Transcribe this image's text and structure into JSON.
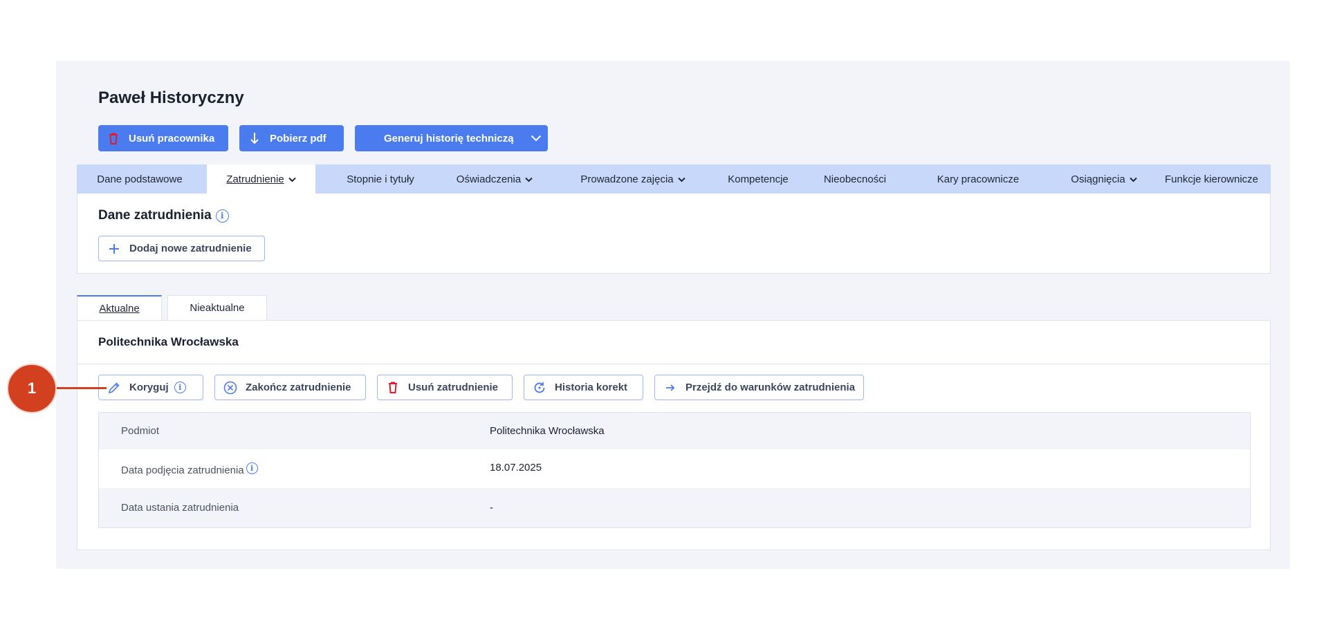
{
  "header": {
    "title": "Paweł Historyczny"
  },
  "actions": {
    "delete_employee": "Usuń pracownika",
    "download_pdf": "Pobierz pdf",
    "generate_history": "Generuj historię techniczą"
  },
  "tabs": [
    {
      "label": "Dane podstawowe"
    },
    {
      "label": "Zatrudnienie",
      "active": true
    },
    {
      "label": "Stopnie i tytuły"
    },
    {
      "label": "Oświadczenia"
    },
    {
      "label": "Prowadzone zajęcia"
    },
    {
      "label": "Kompetencje"
    },
    {
      "label": "Nieobecności"
    },
    {
      "label": "Kary pracownicze"
    },
    {
      "label": "Osiągnięcia"
    },
    {
      "label": "Funkcje kierownicze"
    }
  ],
  "employment": {
    "section_title": "Dane zatrudnienia",
    "add_button": "Dodaj nowe zatrudnienie"
  },
  "subtabs": [
    {
      "label": "Aktualne",
      "active": true
    },
    {
      "label": "Nieaktualne"
    }
  ],
  "current": {
    "organization": "Politechnika Wrocławska",
    "buttons": {
      "correct": "Koryguj",
      "end": "Zakończ zatrudnienie",
      "delete": "Usuń zatrudnienie",
      "history": "Historia korekt",
      "goto_conditions": "Przejdź do warunków zatrudnienia"
    },
    "rows": [
      {
        "label": "Podmiot",
        "value": "Politechnika Wrocławska"
      },
      {
        "label": "Data podjęcia zatrudnienia",
        "value": "18.07.2025"
      },
      {
        "label": "Data ustania zatrudnienia",
        "value": "-"
      }
    ]
  },
  "annotation": {
    "marker": "1"
  },
  "colors": {
    "accent": "#4a7cf0",
    "tabbar": "#c7d8fb",
    "marker": "#d3401f",
    "danger": "#e5192e"
  }
}
